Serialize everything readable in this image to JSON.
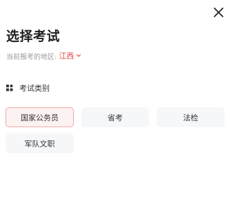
{
  "header": {
    "close_icon": "close-icon",
    "title": "选择考试"
  },
  "region": {
    "label": "当前报考的地区:",
    "value": "江西",
    "value_color": "#e0443f",
    "chevron_icon": "chevron-down-icon"
  },
  "section": {
    "icon": "grid-icon",
    "title": "考试类别"
  },
  "categories": [
    {
      "label": "国家公务员",
      "selected": true
    },
    {
      "label": "省考",
      "selected": false
    },
    {
      "label": "法检",
      "selected": false
    },
    {
      "label": "军队文职",
      "selected": false
    }
  ],
  "colors": {
    "accent": "#e0443f",
    "selected_border": "#f0a9a7",
    "selected_bg": "#fdf2f2",
    "chip_bg": "#f6f7f9"
  }
}
